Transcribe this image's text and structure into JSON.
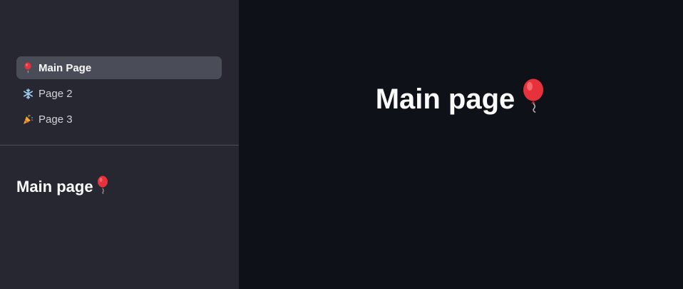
{
  "sidebar": {
    "nav_items": [
      {
        "label": "Main Page",
        "icon": "balloon-icon",
        "active": true
      },
      {
        "label": "Page 2",
        "icon": "snowflake-icon",
        "active": false
      },
      {
        "label": "Page 3",
        "icon": "party-popper-icon",
        "active": false
      }
    ],
    "heading": "Main page"
  },
  "main": {
    "title": "Main page"
  },
  "colors": {
    "sidebar_bg": "#262730",
    "main_bg": "#0e1117",
    "active_item_bg": "#4a4c57",
    "text": "#fafafa",
    "balloon_red": "#e8323b"
  }
}
